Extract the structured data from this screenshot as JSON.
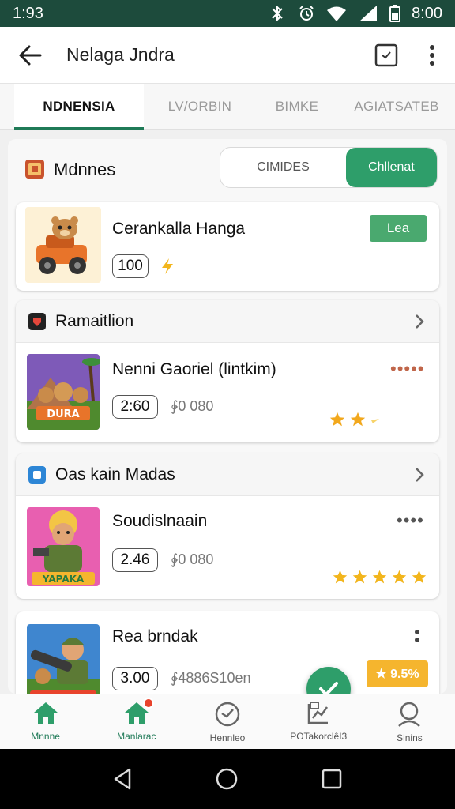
{
  "status": {
    "time": "1:93",
    "right_text": "8:00"
  },
  "appbar": {
    "title": "Nelaga Jndra",
    "back_icon": "arrow-left-icon",
    "action_icon": "checkbox-icon",
    "menu_icon": "more-vert-icon"
  },
  "tabs": [
    "NDNENSIA",
    "LV/ORBIN",
    "BIMKE",
    "AGIATSATEB"
  ],
  "section": {
    "title": "Mdnnes",
    "segment": [
      "CIMIDES",
      "Chllenat"
    ]
  },
  "featured": {
    "name": "Cerankalla Hanga",
    "count": "100",
    "button": "Lea"
  },
  "group1": {
    "title": "Ramaitlion",
    "item": {
      "name": "Nenni Gaoriel (lintkim)",
      "count": "2:60",
      "sub": "∲0 080",
      "thumb_caption": "DURA",
      "rating": 2
    }
  },
  "group2": {
    "title": "Oas kain Madas",
    "item": {
      "name": "Soudislnaain",
      "count": "2.46",
      "sub": "∲0 080",
      "thumb_caption": "YAPAKA",
      "rating": 5
    }
  },
  "item3": {
    "name": "Rea brndak",
    "count": "3.00",
    "sub": "∲4886S10en",
    "badge": "★ 9.5%"
  },
  "bottom_nav": [
    {
      "label": "Mnnne",
      "icon": "home-icon",
      "active": true
    },
    {
      "label": "Manlarac",
      "icon": "home-icon",
      "active": true,
      "notification": true
    },
    {
      "label": "Hennleo",
      "icon": "compass-icon",
      "active": false
    },
    {
      "label": "POTakorclêI3",
      "icon": "chart-icon",
      "active": false
    },
    {
      "label": "Sinins",
      "icon": "profile-icon",
      "active": false
    }
  ],
  "colors": {
    "primary": "#2e9e6a",
    "status_bar": "#1d4b3c",
    "star": "#f2a81d",
    "dots": "#c0664a"
  }
}
